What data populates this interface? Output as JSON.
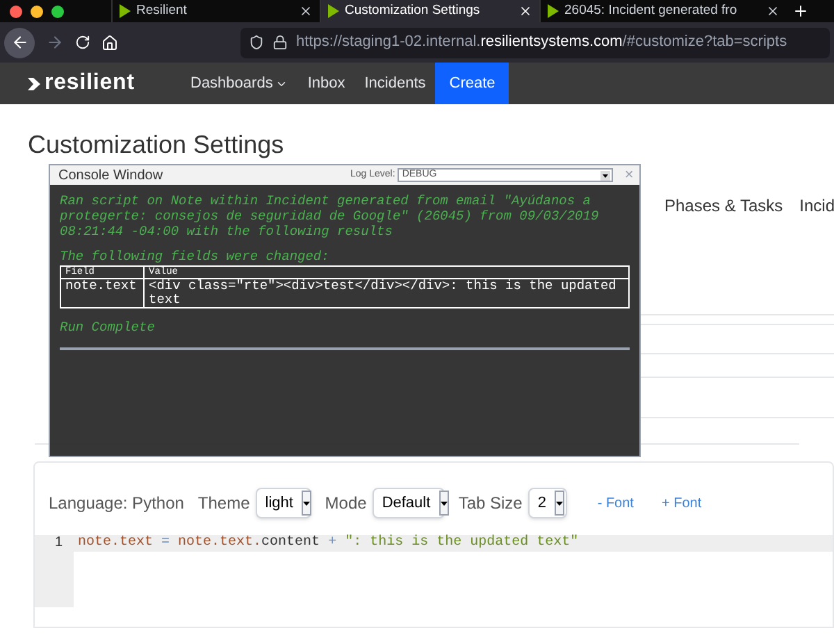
{
  "browser": {
    "tabs": [
      {
        "title": "Resilient",
        "selected": false
      },
      {
        "title": "Customization Settings",
        "selected": true
      },
      {
        "title": "26045: Incident generated fro",
        "selected": false
      }
    ],
    "url": {
      "host_prefix": "https://staging1-02.internal.",
      "domain": "resilientsystems.com",
      "path": "/#customize?tab=scripts"
    }
  },
  "navbar": {
    "logo": "resilient",
    "items": [
      {
        "label": "Dashboards",
        "dropdown": true,
        "kind": "menu"
      },
      {
        "label": "Inbox",
        "dropdown": false,
        "kind": "menu"
      },
      {
        "label": "Incidents",
        "dropdown": false,
        "kind": "menu"
      },
      {
        "label": "Create",
        "dropdown": false,
        "kind": "primary"
      }
    ]
  },
  "page_title": "Customization Settings",
  "tabs": [
    {
      "label": "Phases & Tasks"
    },
    {
      "label": "Incid"
    }
  ],
  "console": {
    "title": "Console Window",
    "log_level_label": "Log Level:",
    "log_level": "DEBUG",
    "close": "×",
    "message": "Ran script on Note within Incident generated from email \"Ayúdanos a protegerte: consejos de seguridad de Google\" (26045) from 09/03/2019 08:21:44 -04:00 with the following results",
    "changed_heading": "The following fields were changed:",
    "table": {
      "columns": [
        "Field",
        "Value"
      ],
      "rows": [
        [
          "note.text",
          "<div class=\"rte\"><div>test</div></div>: this is the updated text"
        ]
      ]
    },
    "footer": "Run Complete"
  },
  "editor": {
    "language": "Language: Python",
    "controls": [
      {
        "label": "Theme",
        "value": "light"
      },
      {
        "label": "Mode",
        "value": "Default"
      },
      {
        "label": "Tab Size",
        "value": "2"
      }
    ],
    "font_buttons": [
      "- Font",
      "+ Font"
    ],
    "lines": [
      {
        "number": "1",
        "tokens": [
          {
            "text": "note.text",
            "kind": "var"
          },
          {
            "text": " = ",
            "kind": "op"
          },
          {
            "text": "note.text.",
            "kind": "var"
          },
          {
            "text": "content",
            "kind": "plain"
          },
          {
            "text": " + ",
            "kind": "op"
          },
          {
            "text": "\": this is the updated text\"",
            "kind": "string"
          }
        ]
      }
    ]
  }
}
